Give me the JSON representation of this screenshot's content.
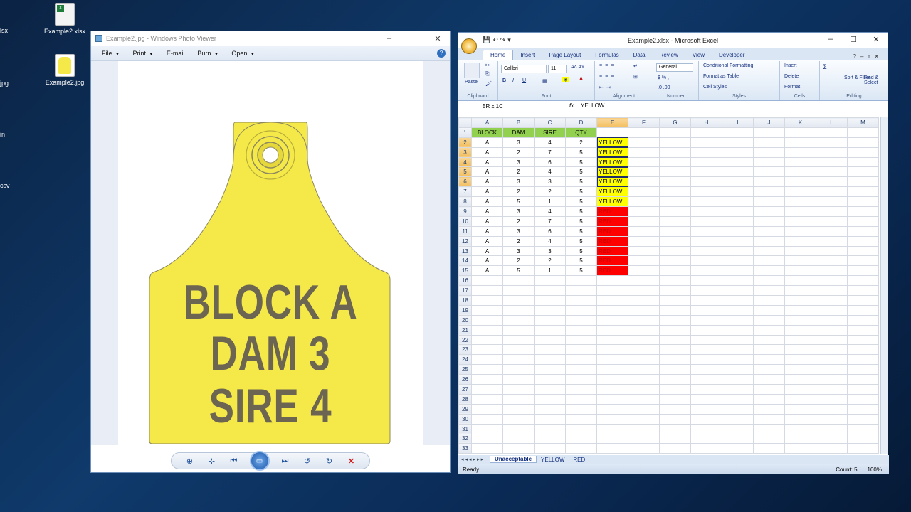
{
  "desktop": {
    "icons": [
      {
        "label": "Example2.xlsx"
      },
      {
        "label": "Example2.jpg"
      }
    ],
    "edge_fragments": [
      "lsx",
      "jpg",
      "in",
      "csv"
    ]
  },
  "photo_viewer": {
    "title": "Example2.jpg - Windows Photo Viewer",
    "menu": [
      "File",
      "Print",
      "E-mail",
      "Burn",
      "Open"
    ],
    "help_label": "?",
    "tag_lines": [
      "BLOCK A",
      "DAM 3",
      "SIRE 4"
    ],
    "tag_color": "#f5e94a"
  },
  "excel": {
    "title": "Example2.xlsx - Microsoft Excel",
    "tabs": [
      "Home",
      "Insert",
      "Page Layout",
      "Formulas",
      "Data",
      "Review",
      "View",
      "Developer"
    ],
    "ribbon": {
      "clipboard": {
        "paste": "Paste",
        "label": "Clipboard"
      },
      "font": {
        "name": "Calibri",
        "size": "11",
        "label": "Font"
      },
      "alignment": {
        "label": "Alignment"
      },
      "number": {
        "format": "General",
        "label": "Number"
      },
      "styles": {
        "conditional": "Conditional Formatting",
        "format_table": "Format as Table",
        "cell_styles": "Cell Styles",
        "label": "Styles"
      },
      "cells": {
        "insert": "Insert",
        "delete": "Delete",
        "format": "Format",
        "label": "Cells"
      },
      "editing": {
        "sort": "Sort & Filter",
        "find": "Find & Select",
        "label": "Editing"
      }
    },
    "name_box": "5R x 1C",
    "formula_value": "YELLOW",
    "columns": [
      "A",
      "B",
      "C",
      "D",
      "E",
      "F",
      "G",
      "H",
      "I",
      "J",
      "K",
      "L",
      "M"
    ],
    "header_row": [
      "BLOCK",
      "DAM",
      "SIRE",
      "QTY"
    ],
    "rows": [
      {
        "a": "A",
        "b": "3",
        "c": "4",
        "d": "2",
        "e": "YELLOW"
      },
      {
        "a": "A",
        "b": "2",
        "c": "7",
        "d": "5",
        "e": "YELLOW"
      },
      {
        "a": "A",
        "b": "3",
        "c": "6",
        "d": "5",
        "e": "YELLOW"
      },
      {
        "a": "A",
        "b": "2",
        "c": "4",
        "d": "5",
        "e": "YELLOW"
      },
      {
        "a": "A",
        "b": "3",
        "c": "3",
        "d": "5",
        "e": "YELLOW"
      },
      {
        "a": "A",
        "b": "2",
        "c": "2",
        "d": "5",
        "e": "YELLOW"
      },
      {
        "a": "A",
        "b": "5",
        "c": "1",
        "d": "5",
        "e": "YELLOW"
      },
      {
        "a": "A",
        "b": "3",
        "c": "4",
        "d": "5",
        "e": "RED"
      },
      {
        "a": "A",
        "b": "2",
        "c": "7",
        "d": "5",
        "e": "RED"
      },
      {
        "a": "A",
        "b": "3",
        "c": "6",
        "d": "5",
        "e": "RED"
      },
      {
        "a": "A",
        "b": "2",
        "c": "4",
        "d": "5",
        "e": "RED"
      },
      {
        "a": "A",
        "b": "3",
        "c": "3",
        "d": "5",
        "e": "RED"
      },
      {
        "a": "A",
        "b": "2",
        "c": "2",
        "d": "5",
        "e": "RED"
      },
      {
        "a": "A",
        "b": "5",
        "c": "1",
        "d": "5",
        "e": "RED"
      }
    ],
    "total_rows": 33,
    "sheets": [
      "Unacceptable",
      "YELLOW",
      "RED"
    ],
    "status": "Ready",
    "count": "Count: 5",
    "zoom": "100%"
  }
}
